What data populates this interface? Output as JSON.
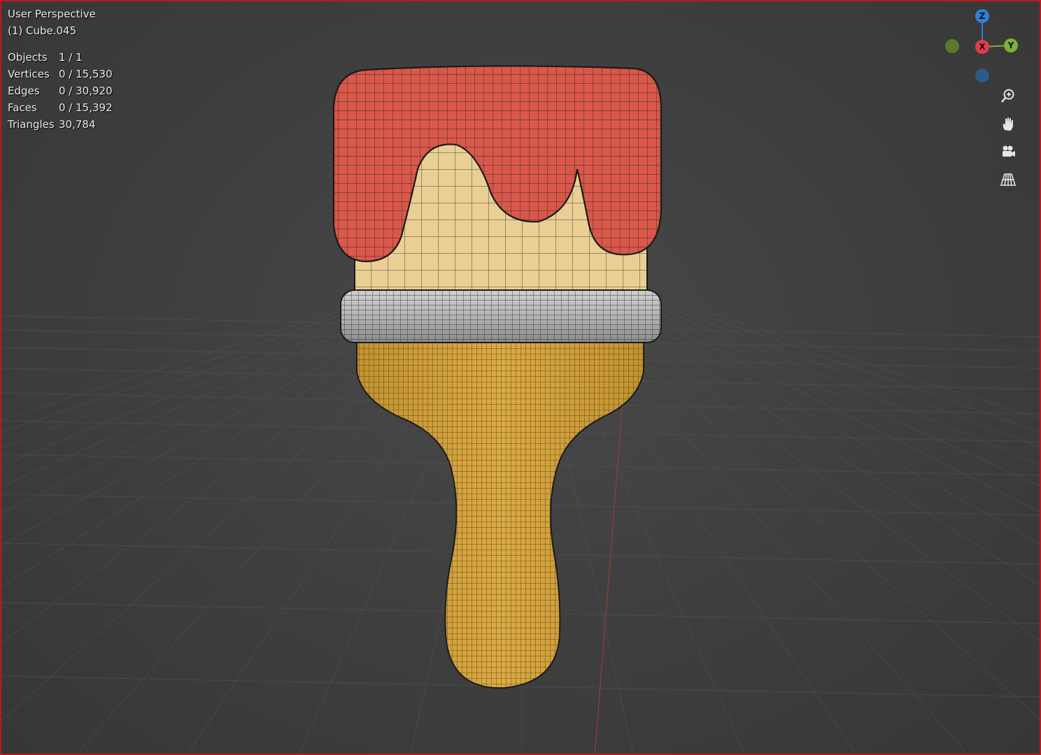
{
  "viewport": {
    "view_name": "User Perspective",
    "object_name": "(1) Cube.045",
    "stats": [
      {
        "label": "Objects",
        "value": "1 / 1"
      },
      {
        "label": "Vertices",
        "value": "0 / 15,530"
      },
      {
        "label": "Edges",
        "value": "0 / 30,920"
      },
      {
        "label": "Faces",
        "value": "0 / 15,392"
      },
      {
        "label": "Triangles",
        "value": "30,784"
      }
    ]
  },
  "gizmo": {
    "z_label": "Z",
    "x_label": "X",
    "y_label": "Y",
    "colors": {
      "x": "#e83a4f",
      "y": "#7cb23a",
      "z": "#2f7fd6",
      "neg_y": "#5a7a2a",
      "neg_z": "#2a5a8a"
    }
  },
  "nav_buttons": [
    {
      "name": "zoom-icon"
    },
    {
      "name": "hand-pan-icon"
    },
    {
      "name": "camera-icon"
    },
    {
      "name": "perspective-grid-icon"
    }
  ],
  "model_colors": {
    "paint": "#d9584a",
    "bristles": "#e9cf94",
    "ferrule": "#b3b3b3",
    "handle": "#d7a43a",
    "wire": "#1e1e1e"
  }
}
